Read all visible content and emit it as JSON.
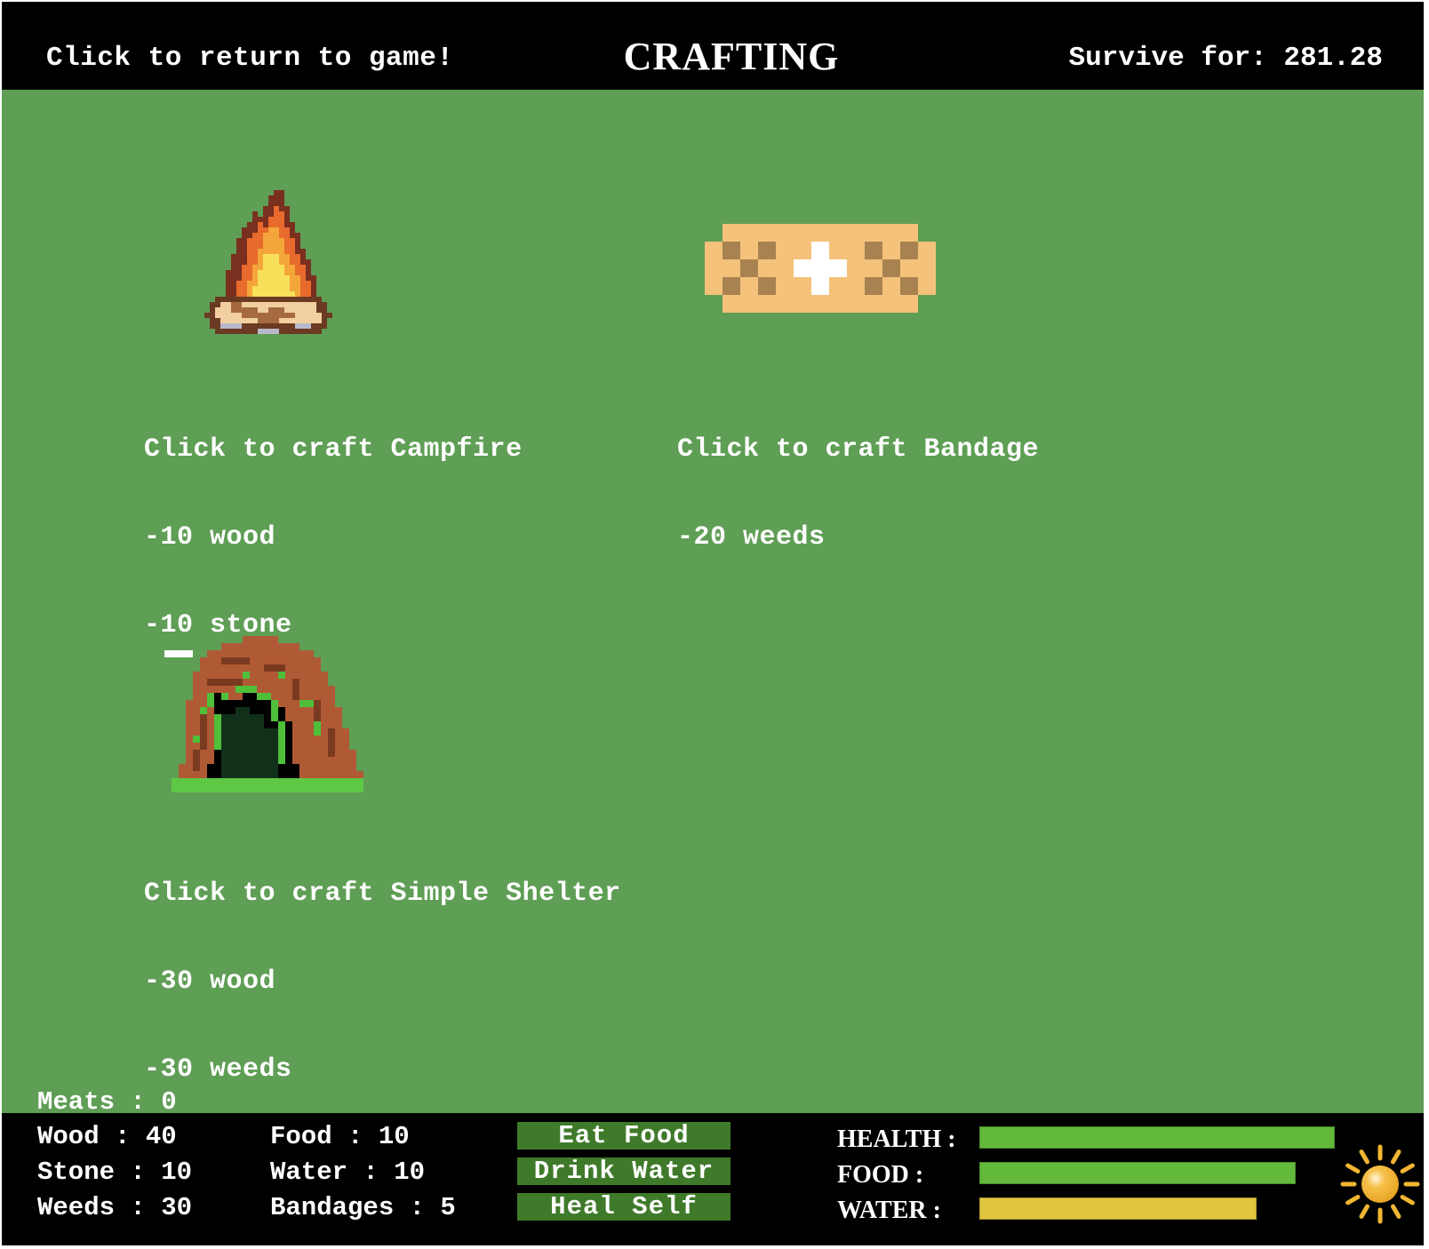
{
  "header": {
    "return_label": "Click to return to game!",
    "title": "CRAFTING",
    "survive_label": "Survive for: 281.28"
  },
  "recipes": [
    {
      "icon": "campfire-icon",
      "title": "Click to craft Campfire",
      "costs": [
        "-10 wood",
        "-10 stone"
      ]
    },
    {
      "icon": "bandage-icon",
      "title": "Click to craft Bandage",
      "costs": [
        "-20 weeds"
      ]
    },
    {
      "icon": "shelter-icon",
      "title": "Click to craft Simple Shelter",
      "costs": [
        "-30 wood",
        "-30 weeds"
      ]
    }
  ],
  "inventory": {
    "meats": "Meats : 0",
    "wood": "Wood : 40",
    "stone": "Stone : 10",
    "weeds": "Weeds : 30",
    "food": "Food : 10",
    "water": "Water : 10",
    "bandages": "Bandages : 5"
  },
  "actions": {
    "eat": "Eat Food",
    "drink": "Drink Water",
    "heal": "Heal Self"
  },
  "status_bars": [
    {
      "label": "HEALTH :",
      "percent": 100,
      "color": "#63b93a"
    },
    {
      "label": "FOOD :",
      "percent": 89,
      "color": "#63b93a"
    },
    {
      "label": "WATER :",
      "percent": 78,
      "color": "#e0c540"
    }
  ],
  "time_of_day_icon": "sun-icon",
  "colors": {
    "background": "#5f9e55",
    "bars_bg": "#000000",
    "button": "#3f7a2a"
  }
}
